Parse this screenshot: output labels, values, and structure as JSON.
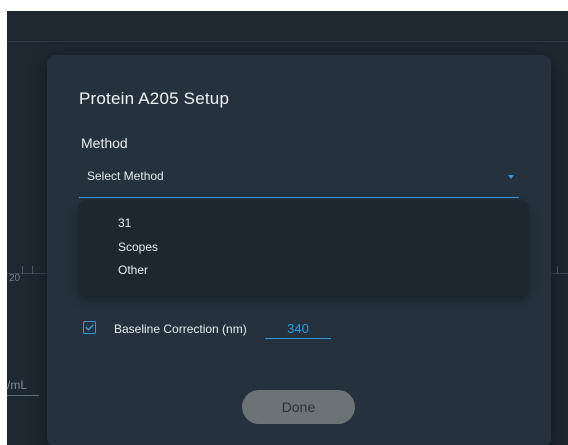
{
  "background": {
    "axis_tick_label": "20",
    "unit_label": "/mL"
  },
  "dialog": {
    "title": "Protein A205 Setup",
    "method_label": "Method",
    "method_select": {
      "value": "Select Method",
      "options": [
        "31",
        "Scopes",
        "Other"
      ],
      "expanded": true
    },
    "baseline": {
      "checked": true,
      "label": "Baseline Correction (nm)",
      "value": "340"
    },
    "done_label": "Done"
  },
  "colors": {
    "accent": "#2f9ae0",
    "dialog_bg": "#25323d",
    "app_bg": "#1d2831",
    "button_disabled": "#6c7377"
  }
}
